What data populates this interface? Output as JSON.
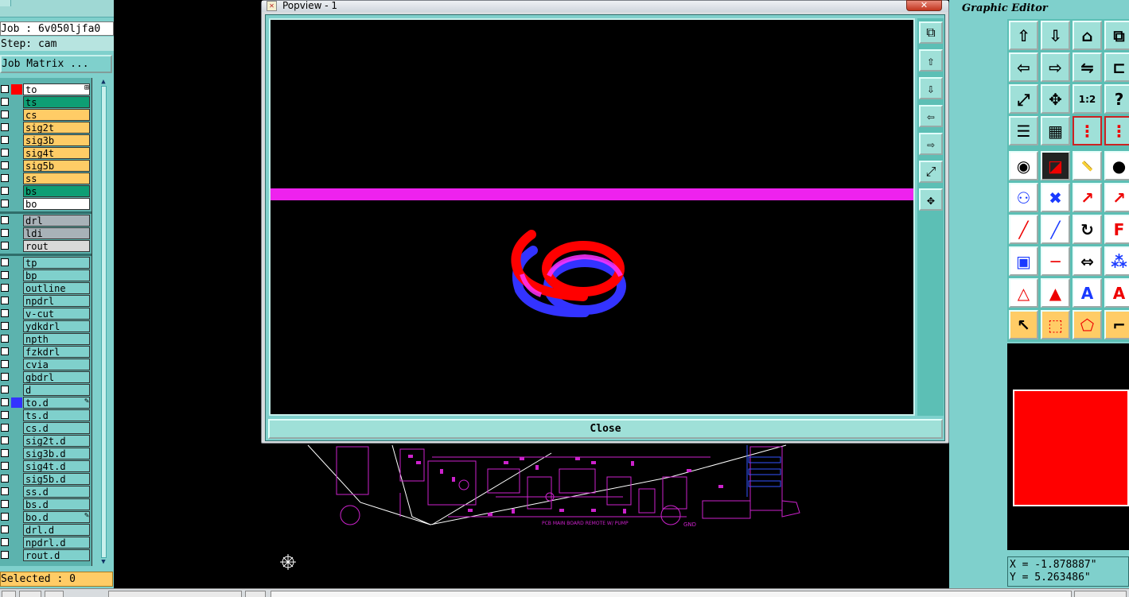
{
  "left_panel": {
    "job_line": "Job : 6v050ljfa0",
    "step_line": "Step: cam",
    "job_matrix_button": "Job Matrix ...",
    "selected_text": "Selected : 0",
    "layers_group1": [
      {
        "name": "to",
        "color": "#ffffff",
        "swatch": "#ff0000",
        "mark": "⊞"
      },
      {
        "name": "ts",
        "color": "#0e9e74"
      },
      {
        "name": "cs",
        "color": "#ffcc66"
      },
      {
        "name": "sig2t",
        "color": "#ffcc66"
      },
      {
        "name": "sig3b",
        "color": "#ffcc66"
      },
      {
        "name": "sig4t",
        "color": "#ffcc66"
      },
      {
        "name": "sig5b",
        "color": "#ffcc66"
      },
      {
        "name": "ss",
        "color": "#ffcc66"
      },
      {
        "name": "bs",
        "color": "#0e9e74"
      },
      {
        "name": "bo",
        "color": "#ffffff"
      }
    ],
    "layers_group2": [
      {
        "name": "drl",
        "color": "#a8b2b8"
      },
      {
        "name": "ldi",
        "color": "#a8b2b8"
      },
      {
        "name": "rout",
        "color": "#d9d9d9"
      }
    ],
    "layers_group3": [
      {
        "name": "tp",
        "color": "#7fd0cc"
      },
      {
        "name": "bp",
        "color": "#7fd0cc"
      },
      {
        "name": "outline",
        "color": "#7fd0cc"
      },
      {
        "name": "npdrl",
        "color": "#7fd0cc"
      },
      {
        "name": "v-cut",
        "color": "#7fd0cc"
      },
      {
        "name": "ydkdrl",
        "color": "#7fd0cc"
      },
      {
        "name": "npth",
        "color": "#7fd0cc"
      },
      {
        "name": "fzkdrl",
        "color": "#7fd0cc"
      },
      {
        "name": "cvia",
        "color": "#7fd0cc"
      },
      {
        "name": "gbdrl",
        "color": "#7fd0cc"
      },
      {
        "name": "d",
        "color": "#7fd0cc"
      },
      {
        "name": "to.d",
        "color": "#7fd0cc",
        "swatch": "#3333ff",
        "mark": "✎"
      },
      {
        "name": "ts.d",
        "color": "#7fd0cc"
      },
      {
        "name": "cs.d",
        "color": "#7fd0cc"
      },
      {
        "name": "sig2t.d",
        "color": "#7fd0cc"
      },
      {
        "name": "sig3b.d",
        "color": "#7fd0cc"
      },
      {
        "name": "sig4t.d",
        "color": "#7fd0cc"
      },
      {
        "name": "sig5b.d",
        "color": "#7fd0cc"
      },
      {
        "name": "ss.d",
        "color": "#7fd0cc"
      },
      {
        "name": "bs.d",
        "color": "#7fd0cc"
      },
      {
        "name": "bo.d",
        "color": "#7fd0cc",
        "mark": "✎"
      },
      {
        "name": "drl.d",
        "color": "#7fd0cc"
      },
      {
        "name": "npdrl.d",
        "color": "#7fd0cc"
      },
      {
        "name": "rout.d",
        "color": "#7fd0cc"
      }
    ]
  },
  "popview": {
    "title": "Popview - 1",
    "close_x": "✕",
    "close_button": "Close",
    "bar_color": "#ee22ee",
    "glyph_top_color": "#ff0000",
    "glyph_bottom_color": "#3333ff",
    "toolbar_icons": [
      "zoom-window-icon",
      "pan-up-icon",
      "pan-down-icon",
      "pan-left-icon",
      "pan-right-icon",
      "zoom-out-icon",
      "zoom-in-icon"
    ]
  },
  "right_panel": {
    "title": "Graphic Editor",
    "coord_x": "X = -1.878887\"",
    "coord_y": "Y = 5.263486\"",
    "tools": [
      [
        "pan-up-icon",
        "pan-down-icon",
        "home-icon",
        "zoom-window-icon"
      ],
      [
        "pan-left-icon",
        "pan-right-icon",
        "zoom-swap-icon",
        "snap-icon"
      ],
      [
        "zoom-fit-icon",
        "zoom-center-icon",
        "ratio-icon",
        "help-icon"
      ],
      [
        "properties-icon",
        "grid-icon",
        "net-select-icon",
        "net-select-alt-icon"
      ],
      [
        "add-pad-icon",
        "add-shape-icon",
        "measure-icon",
        "add-dot-icon"
      ],
      [
        "move-icon",
        "delete-icon",
        "connect-icon",
        "connect-alt-icon"
      ],
      [
        "line-icon",
        "line-alt-icon",
        "arc-icon",
        "text-icon"
      ],
      [
        "pad-icon",
        "line-edit-icon",
        "resize-icon",
        "group-icon"
      ],
      [
        "triangle-icon",
        "triangle-alt-icon",
        "triangle-text-icon",
        "triangle-red-icon"
      ],
      [
        "select-icon",
        "select-box-icon",
        "select-poly-icon",
        "select-net-icon"
      ]
    ]
  },
  "canvas": {
    "board_text_1": "PCB MAIN BOARD REMOTE W/ PUMP",
    "board_text_2": "GND"
  }
}
